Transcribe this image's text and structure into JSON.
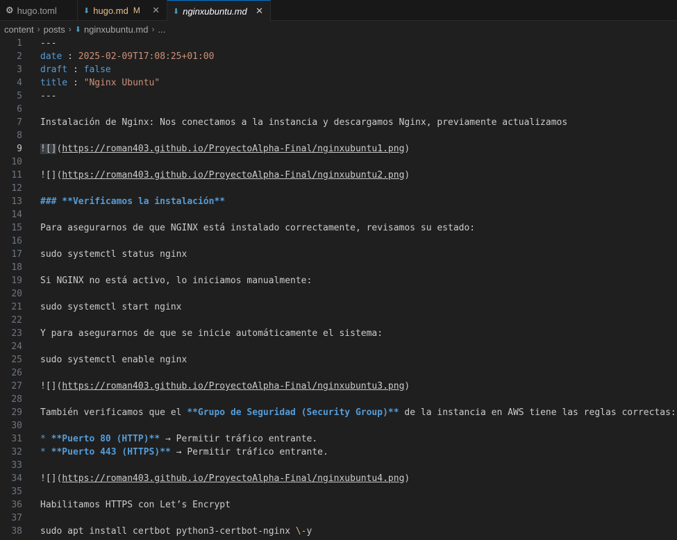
{
  "tabs": [
    {
      "name": "hugo.toml",
      "modified": "",
      "icon": "gear-icon"
    },
    {
      "name": "hugo.md",
      "modified": "M",
      "icon": "markdown-icon"
    },
    {
      "name": "nginxubuntu.md",
      "modified": "",
      "icon": "markdown-icon"
    }
  ],
  "breadcrumb": {
    "items": [
      "content",
      "posts",
      "nginxubuntu.md",
      "..."
    ]
  },
  "editor": {
    "lines": [
      {
        "n": "1",
        "text": "---"
      },
      {
        "n": "2",
        "key": "date",
        "sep": " : ",
        "value": "2025-02-09T17:08:25+01:00"
      },
      {
        "n": "3",
        "key": "draft",
        "sep": " : ",
        "value": "false"
      },
      {
        "n": "4",
        "key": "title",
        "sep": " : ",
        "value": "\"Nginx Ubuntu\""
      },
      {
        "n": "5",
        "text": "---"
      },
      {
        "n": "6",
        "text": ""
      },
      {
        "n": "7",
        "text": "Instalación de Nginx: Nos conectamos a la instancia y descargamos Nginx, previamente actualizamos"
      },
      {
        "n": "8",
        "text": ""
      },
      {
        "n": "9",
        "prefix": "![]",
        "paren_open": "(",
        "url": "https://roman403.github.io/ProyectoAlpha-Final/nginxubuntu1.png",
        "paren_close": ")"
      },
      {
        "n": "10",
        "text": ""
      },
      {
        "n": "11",
        "prefix": "![]",
        "paren_open": "(",
        "url": "https://roman403.github.io/ProyectoAlpha-Final/nginxubuntu2.png",
        "paren_close": ")"
      },
      {
        "n": "12",
        "text": ""
      },
      {
        "n": "13",
        "heading": "### **Verificamos la instalación**"
      },
      {
        "n": "14",
        "text": ""
      },
      {
        "n": "15",
        "text": "Para asegurarnos de que NGINX está instalado correctamente, revisamos su estado:"
      },
      {
        "n": "16",
        "text": ""
      },
      {
        "n": "17",
        "text": "sudo systemctl status nginx"
      },
      {
        "n": "18",
        "text": ""
      },
      {
        "n": "19",
        "text": "Si NGINX no está activo, lo iniciamos manualmente:"
      },
      {
        "n": "20",
        "text": ""
      },
      {
        "n": "21",
        "text": "sudo systemctl start nginx"
      },
      {
        "n": "22",
        "text": ""
      },
      {
        "n": "23",
        "text": "Y para asegurarnos de que se inicie automáticamente el sistema:"
      },
      {
        "n": "24",
        "text": ""
      },
      {
        "n": "25",
        "text": "sudo systemctl enable nginx"
      },
      {
        "n": "26",
        "text": ""
      },
      {
        "n": "27",
        "prefix": "![]",
        "paren_open": "(",
        "url": "https://roman403.github.io/ProyectoAlpha-Final/nginxubuntu3.png",
        "paren_close": ")"
      },
      {
        "n": "28",
        "text": ""
      },
      {
        "n": "29",
        "before": "También verificamos que el ",
        "bold": "**Grupo de Seguridad (Security Group)**",
        "after": " de la instancia en AWS tiene las reglas correctas:"
      },
      {
        "n": "30",
        "text": ""
      },
      {
        "n": "31",
        "bullet": "* ",
        "bold": "**Puerto 80 (HTTP)**",
        "after": " → Permitir tráfico entrante."
      },
      {
        "n": "32",
        "bullet": "* ",
        "bold": "**Puerto 443 (HTTPS)**",
        "after": " → Permitir tráfico entrante."
      },
      {
        "n": "33",
        "text": ""
      },
      {
        "n": "34",
        "prefix": "![]",
        "paren_open": "(",
        "url": "https://roman403.github.io/ProyectoAlpha-Final/nginxubuntu4.png",
        "paren_close": ")"
      },
      {
        "n": "35",
        "text": ""
      },
      {
        "n": "36",
        "text": "Habilitamos HTTPS con Let’s Encrypt"
      },
      {
        "n": "37",
        "text": ""
      },
      {
        "n": "38",
        "before": "sudo apt install certbot python3-certbot-nginx ",
        "esc": "\\-",
        "after": "y"
      }
    ]
  }
}
